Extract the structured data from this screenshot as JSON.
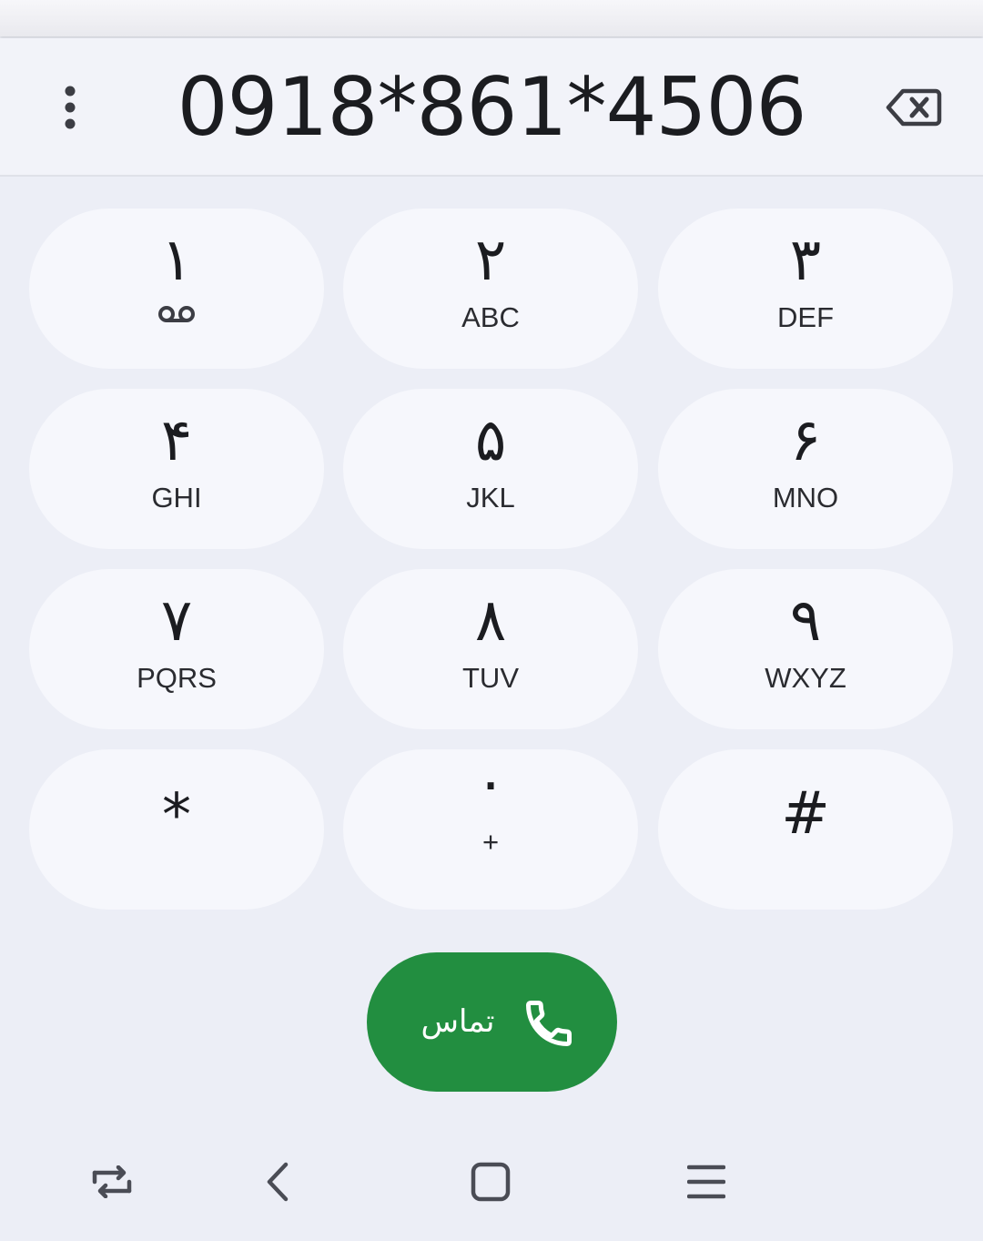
{
  "dialer": {
    "number": "0918*861*4506"
  },
  "keypad": {
    "keys": [
      {
        "digit": "١",
        "letters": ""
      },
      {
        "digit": "٢",
        "letters": "ABC"
      },
      {
        "digit": "٣",
        "letters": "DEF"
      },
      {
        "digit": "۴",
        "letters": "GHI"
      },
      {
        "digit": "۵",
        "letters": "JKL"
      },
      {
        "digit": "۶",
        "letters": "MNO"
      },
      {
        "digit": "٧",
        "letters": "PQRS"
      },
      {
        "digit": "٨",
        "letters": "TUV"
      },
      {
        "digit": "٩",
        "letters": "WXYZ"
      },
      {
        "digit": "*",
        "letters": ""
      },
      {
        "digit": "٠",
        "letters": "+"
      },
      {
        "digit": "#",
        "letters": ""
      }
    ]
  },
  "call": {
    "label": "تماس"
  },
  "icons": {
    "overflow": "more-vert-icon",
    "backspace": "backspace-icon",
    "voicemail": "voicemail-icon",
    "call": "phone-icon",
    "nav_recents": "recent-apps-icon",
    "nav_back": "back-icon",
    "nav_home": "home-icon",
    "nav_menu": "menu-icon"
  },
  "colors": {
    "background": "#eceef6",
    "key_background": "#f6f7fc",
    "call_button": "#228e40",
    "text": "#1b1c20"
  }
}
